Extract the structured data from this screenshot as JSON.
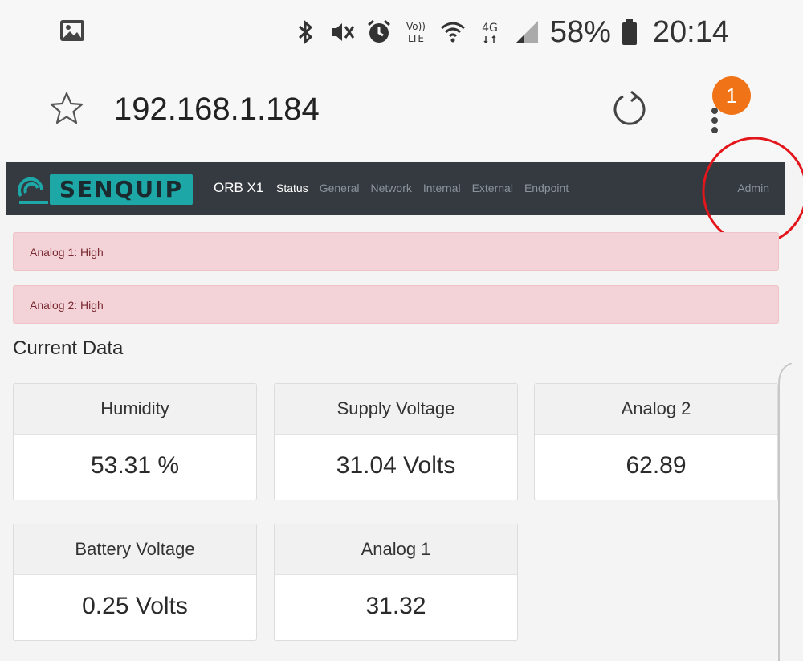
{
  "status_bar": {
    "left_icon": "image-icon",
    "icons": [
      "bluetooth-icon",
      "mute-icon",
      "alarm-icon",
      "volte-icon",
      "wifi-icon",
      "4g-icon",
      "signal-icon"
    ],
    "volte_label": "Vo)) LTE",
    "net_label": "4G",
    "battery_percent": "58%",
    "battery_icon": "battery-icon",
    "time": "20:14"
  },
  "browser": {
    "url": "192.168.1.184",
    "notification_count": "1"
  },
  "navbar": {
    "logo_text": "SENQUIP",
    "brand": "ORB X1",
    "links": [
      "Status",
      "General",
      "Network",
      "Internal",
      "External",
      "Endpoint"
    ],
    "active_link": "Status",
    "admin": "Admin",
    "bg_color": "#343a40",
    "logo_color": "#1ea7a7"
  },
  "alerts": [
    {
      "text": "Analog 1: High"
    },
    {
      "text": "Analog 2: High"
    }
  ],
  "section_title": "Current Data",
  "cards": [
    {
      "label": "Humidity",
      "value": "53.31 %"
    },
    {
      "label": "Supply Voltage",
      "value": "31.04 Volts"
    },
    {
      "label": "Analog 2",
      "value": "62.89"
    },
    {
      "label": "Battery Voltage",
      "value": "0.25 Volts"
    },
    {
      "label": "Analog 1",
      "value": "31.32"
    }
  ],
  "colors": {
    "alert_bg": "#f3d3d7",
    "alert_text": "#7a2a33",
    "badge": "#f07417",
    "annotation": "#e3161b"
  }
}
